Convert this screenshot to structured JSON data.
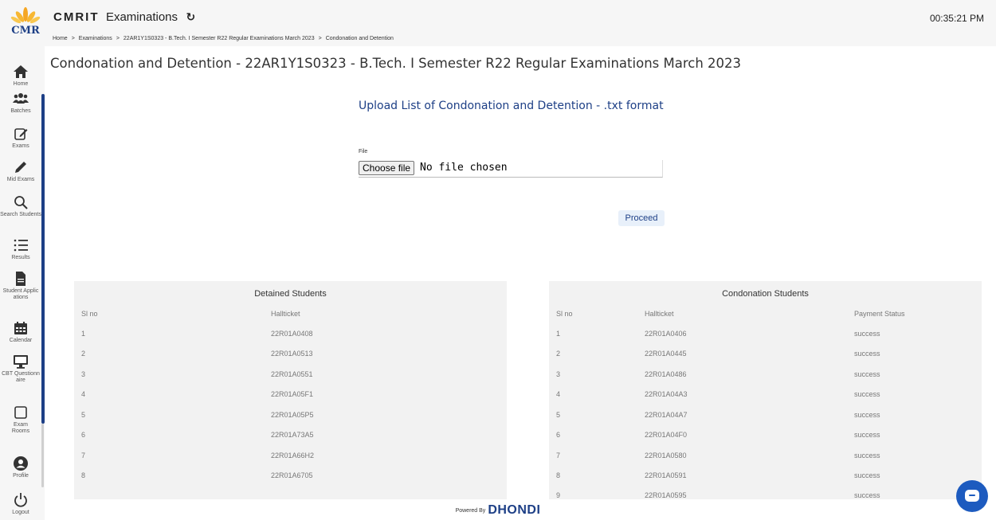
{
  "header": {
    "logo_text": "CMR",
    "brand": "CMRIT",
    "app_name": "Examinations",
    "clock": "00:35:21 PM"
  },
  "breadcrumb": [
    "Home",
    "Examinations",
    "22AR1Y1S0323 - B.Tech. I Semester R22 Regular Examinations March 2023",
    "Condonation and Detention"
  ],
  "sidebar": {
    "items": [
      {
        "label": "Home",
        "icon": "home-icon"
      },
      {
        "label": "Batches",
        "icon": "users-icon"
      },
      {
        "label": "Exams",
        "icon": "edit-icon"
      },
      {
        "label": "Mid Exams",
        "icon": "pencil-icon"
      },
      {
        "label": "Search Students",
        "icon": "search-icon"
      },
      {
        "label": "Results",
        "icon": "list-icon"
      },
      {
        "label": "Student Applications",
        "icon": "document-icon"
      },
      {
        "label": "Calendar",
        "icon": "calendar-icon"
      },
      {
        "label": "CBT Questionnaire",
        "icon": "monitor-icon"
      },
      {
        "label": "Exam Rooms",
        "icon": "square-icon"
      },
      {
        "label": "Profile",
        "icon": "profile-icon"
      },
      {
        "label": "Logout",
        "icon": "power-icon"
      }
    ]
  },
  "main": {
    "page_title": "Condonation and Detention - 22AR1Y1S0323 - B.Tech. I Semester R22 Regular Examinations March 2023",
    "upload_title": "Upload List of Condonation and Detention - .txt format",
    "file_label": "File",
    "choose_file_label": "Choose file",
    "no_file_text": "No file chosen",
    "proceed_label": "Proceed"
  },
  "detained": {
    "title": "Detained Students",
    "headers": [
      "Sl no",
      "Hallticket"
    ],
    "rows": [
      [
        "1",
        "22R01A0408"
      ],
      [
        "2",
        "22R01A0513"
      ],
      [
        "3",
        "22R01A0551"
      ],
      [
        "4",
        "22R01A05F1"
      ],
      [
        "5",
        "22R01A05P5"
      ],
      [
        "6",
        "22R01A73A5"
      ],
      [
        "7",
        "22R01A66H2"
      ],
      [
        "8",
        "22R01A6705"
      ]
    ]
  },
  "condonation": {
    "title": "Condonation Students",
    "headers": [
      "Sl no",
      "Hallticket",
      "Payment Status"
    ],
    "rows": [
      [
        "1",
        "22R01A0406",
        "success"
      ],
      [
        "2",
        "22R01A0445",
        "success"
      ],
      [
        "3",
        "22R01A0486",
        "success"
      ],
      [
        "4",
        "22R01A04A3",
        "success"
      ],
      [
        "5",
        "22R01A04A7",
        "success"
      ],
      [
        "6",
        "22R01A04F0",
        "success"
      ],
      [
        "7",
        "22R01A0580",
        "success"
      ],
      [
        "8",
        "22R01A0591",
        "success"
      ],
      [
        "9",
        "22R01A0595",
        "success"
      ]
    ]
  },
  "footer": {
    "powered_by": "Powered By",
    "brand": "DHONDI"
  },
  "colors": {
    "primary": "#1d3f86",
    "panel_bg": "#f2f2f2",
    "chat_button": "#1d5bbf"
  }
}
